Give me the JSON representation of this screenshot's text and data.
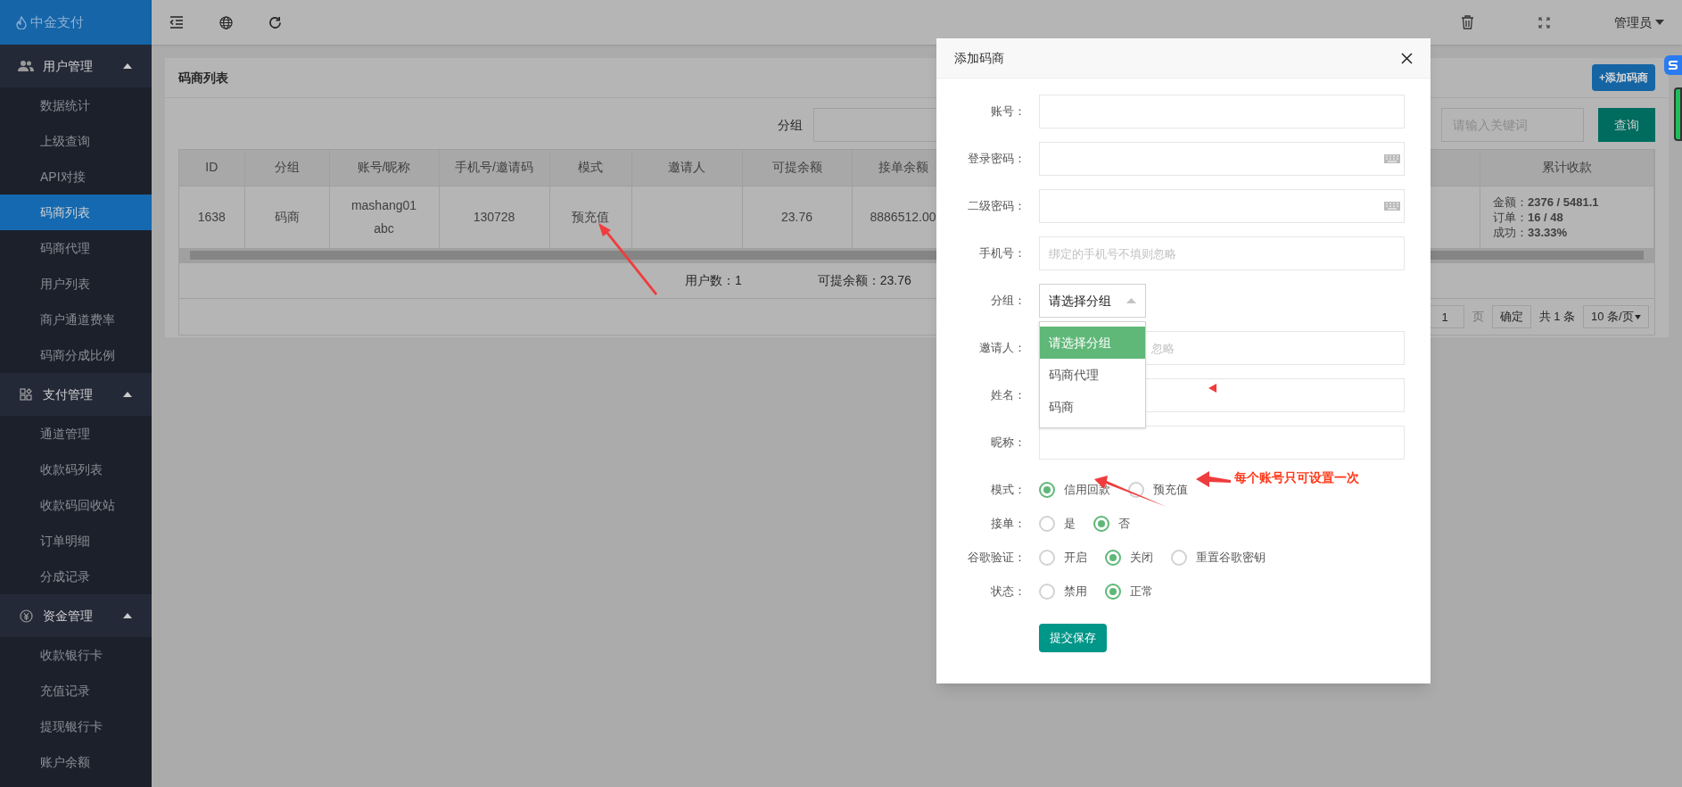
{
  "sidebar": {
    "logo": "中金支付",
    "sections": [
      {
        "title": "用户管理",
        "expanded": true,
        "items": [
          {
            "label": "数据统计",
            "selected": false
          },
          {
            "label": "上级查询",
            "selected": false
          },
          {
            "label": "API对接",
            "selected": false
          },
          {
            "label": "码商列表",
            "selected": true
          },
          {
            "label": "码商代理",
            "selected": false
          },
          {
            "label": "用户列表",
            "selected": false
          },
          {
            "label": "商户通道费率",
            "selected": false
          },
          {
            "label": "码商分成比例",
            "selected": false
          }
        ]
      },
      {
        "title": "支付管理",
        "expanded": true,
        "items": [
          {
            "label": "通道管理",
            "selected": false
          },
          {
            "label": "收款码列表",
            "selected": false
          },
          {
            "label": "收款码回收站",
            "selected": false
          },
          {
            "label": "订单明细",
            "selected": false
          },
          {
            "label": "分成记录",
            "selected": false
          }
        ]
      },
      {
        "title": "资金管理",
        "expanded": true,
        "items": [
          {
            "label": "收款银行卡",
            "selected": false
          },
          {
            "label": "充值记录",
            "selected": false
          },
          {
            "label": "提现银行卡",
            "selected": false
          },
          {
            "label": "账户余额",
            "selected": false
          }
        ]
      }
    ]
  },
  "topbar": {
    "user": "管理员"
  },
  "card": {
    "title": "码商列表",
    "add_button": "+添加码商",
    "filter_label": "分组",
    "keyword_placeholder": "请输入关键词",
    "search_button": "查询"
  },
  "table": {
    "columns": [
      "ID",
      "分组",
      "账号/昵称",
      "手机号/邀请码",
      "模式",
      "邀请人",
      "可提余额",
      "接单余额",
      "累计收款"
    ],
    "rows": [
      {
        "cells": [
          "1638",
          "码商",
          [
            "mashang01",
            "abc"
          ],
          "130728",
          "预充值",
          "",
          "23.76",
          "8886512.00",
          [
            "金额：**2376 / 5481.1**",
            "订单：**16 / 48**",
            "成功：**33.33%**"
          ]
        ]
      }
    ]
  },
  "summary": [
    "用户数：1",
    "可提余额：23.76"
  ],
  "pagination": {
    "page": "1",
    "page_label": "页",
    "confirm": "确定",
    "total": "共 1 条",
    "page_size": "10 条/页"
  },
  "modal": {
    "title": "添加码商",
    "fields": [
      {
        "kind": "text",
        "label": "账号："
      },
      {
        "kind": "password",
        "label": "登录密码："
      },
      {
        "kind": "password",
        "label": "二级密码："
      },
      {
        "kind": "text",
        "label": "手机号：",
        "placeholder": "绑定的手机号不填则忽略"
      },
      {
        "kind": "select",
        "label": "分组：",
        "value": "请选择分组",
        "open": true,
        "options": [
          {
            "label": "请选择分组",
            "selected": true
          },
          {
            "label": "码商代理",
            "selected": false
          },
          {
            "label": "码商",
            "selected": false
          }
        ]
      },
      {
        "kind": "text",
        "label": "邀请人：",
        "placeholder": "忽略"
      },
      {
        "kind": "text",
        "label": "姓名："
      },
      {
        "kind": "text",
        "label": "昵称："
      },
      {
        "kind": "radio",
        "label": "模式：",
        "options": [
          {
            "label": "信用回款",
            "selected": true
          },
          {
            "label": "预充值",
            "selected": false
          }
        ]
      },
      {
        "kind": "radio",
        "label": "接单：",
        "options": [
          {
            "label": "是",
            "selected": false
          },
          {
            "label": "否",
            "selected": true
          }
        ]
      },
      {
        "kind": "radio",
        "label": "谷歌验证：",
        "options": [
          {
            "label": "开启",
            "selected": false
          },
          {
            "label": "关闭",
            "selected": true
          },
          {
            "label": "重置谷歌密钥",
            "selected": false
          }
        ]
      },
      {
        "kind": "radio",
        "label": "状态：",
        "options": [
          {
            "label": "禁用",
            "selected": false
          },
          {
            "label": "正常",
            "selected": true
          }
        ]
      }
    ],
    "submit": "提交保存"
  },
  "annotation": {
    "note": "每个账号只可设置一次"
  }
}
